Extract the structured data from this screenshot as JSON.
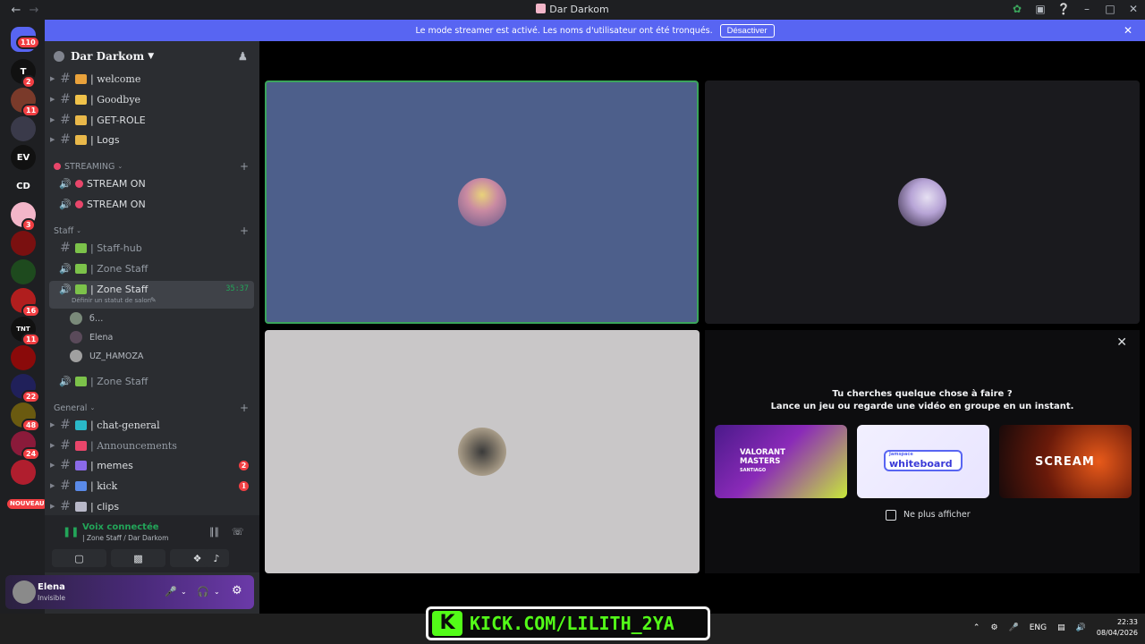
{
  "window": {
    "title": "Dar Darkom"
  },
  "rail": {
    "home_badge": "110",
    "servers": [
      {
        "badge": "2",
        "color": "#111111",
        "letter": "T"
      },
      {
        "badge": "11",
        "color": "#7a3a2a"
      },
      {
        "badge": "",
        "color": "#3a3a4a"
      },
      {
        "badge": "",
        "color": "#111111",
        "letter": "EV"
      },
      {
        "badge": "",
        "color": "",
        "letter": "CD"
      },
      {
        "badge": "3",
        "color": "#f3b6c9"
      },
      {
        "badge": "",
        "color": "#7a1010"
      },
      {
        "badge": "",
        "color": "#1e4a1e"
      },
      {
        "badge": "16",
        "color": "#b01e1e"
      },
      {
        "badge": "11",
        "color": "#111111",
        "letter": "TNT"
      },
      {
        "badge": "",
        "color": "#8a0a0a"
      },
      {
        "badge": "22",
        "color": "#20205a"
      },
      {
        "badge": "48",
        "color": "#6a5a10"
      },
      {
        "badge": "24",
        "color": "#8a1a3a"
      },
      {
        "badge": "",
        "color": "#b01e2e"
      }
    ],
    "new_label": "NOUVEAU"
  },
  "banner": {
    "text": "Le mode streamer est activé. Les noms d'utilisateur ont été tronqués.",
    "button": "Désactiver"
  },
  "guild": {
    "name": "Dar Darkom"
  },
  "channels_top": [
    {
      "name": "| welcome",
      "emoji_color": "#e9a23b",
      "serif": true
    },
    {
      "name": "| Goodbye",
      "emoji_color": "#f0c24a",
      "serif": true
    },
    {
      "name": "| GET-ROLE",
      "emoji_color": "#e9b84a",
      "serif": false
    },
    {
      "name": "| Logs",
      "emoji_color": "#e9b84a",
      "serif": false
    }
  ],
  "streaming": {
    "category": "STREAMING",
    "channels": [
      "STREAM ON",
      "STREAM ON"
    ]
  },
  "staff": {
    "category": "Staff",
    "channels": [
      {
        "name": "| Staff-hub",
        "dim": true,
        "type": "text"
      },
      {
        "name": "| Zone Staff",
        "dim": true,
        "type": "voice"
      },
      {
        "name": "| Zone Staff",
        "dim": false,
        "type": "voice",
        "timer": "35:37",
        "status": "Définir un statut de salon"
      }
    ],
    "voice_users": [
      "б…",
      "Elena",
      "UZ_HAMOZA"
    ],
    "after": "| Zone Staff"
  },
  "general": {
    "category": "General",
    "channels": [
      {
        "name": "| chat-general",
        "serif": true,
        "dim": false,
        "badge": ""
      },
      {
        "name": "| Announcements",
        "serif": true,
        "dim": true,
        "badge": ""
      },
      {
        "name": "| memes",
        "serif": false,
        "dim": false,
        "badge": "2"
      },
      {
        "name": "| kick",
        "serif": true,
        "dim": false,
        "badge": "1"
      },
      {
        "name": "| clips",
        "serif": false,
        "dim": false,
        "badge": ""
      }
    ]
  },
  "voice_panel": {
    "status": "Voix connectée",
    "location": "| Zone Staff / Dar Darkom"
  },
  "user": {
    "name": "Elena",
    "status": "Invisible"
  },
  "activity": {
    "title": "Tu cherches quelque chose à faire ?",
    "subtitle": "Lance un jeu ou regarde une vidéo en groupe en un instant.",
    "cards": [
      {
        "label": "VALORANT MASTERS",
        "sub": "SANTIAGO"
      },
      {
        "label": "whiteboard",
        "sub": "Jamspace"
      },
      {
        "label": "SCREAM",
        "sub": ""
      }
    ],
    "dont_show": "Ne plus afficher"
  },
  "overlay": {
    "kick_url": "KICK.COM/LILITH_2YA"
  },
  "tray": {
    "lang": "ENG",
    "time": "22:33",
    "date": "08/04/2026"
  }
}
